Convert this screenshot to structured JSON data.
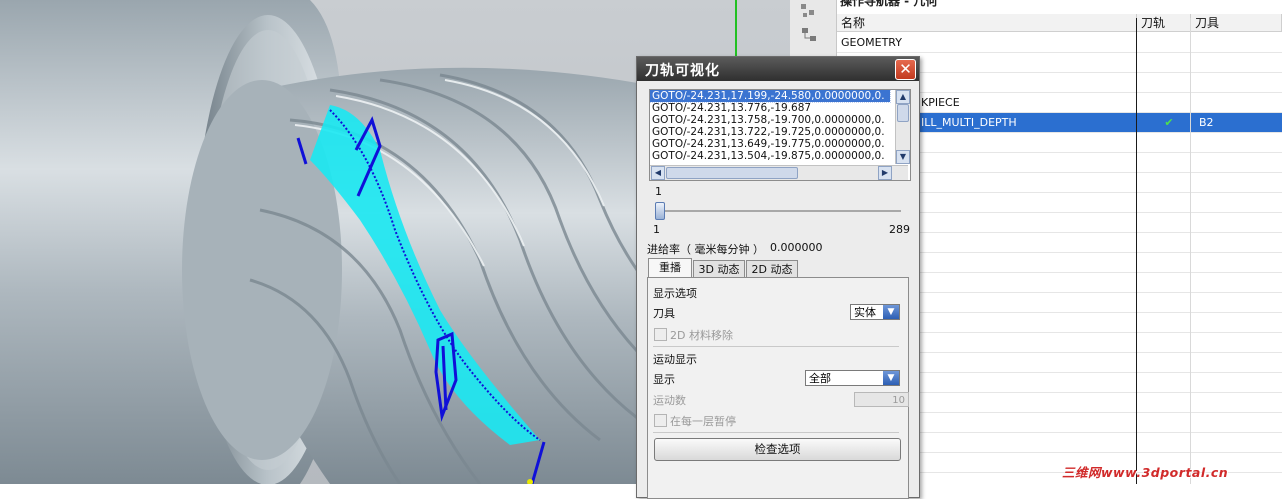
{
  "navigator": {
    "title": "操作导航器 - 几何",
    "columns": {
      "name": "名称",
      "path": "刀轨",
      "tool": "刀具"
    },
    "rows": [
      {
        "name": "GEOMETRY",
        "path": "",
        "tool": ""
      },
      {
        "name": "",
        "path": "",
        "tool": ""
      },
      {
        "name": "",
        "path": "",
        "tool": ""
      },
      {
        "name": "KPIECE",
        "path": "",
        "tool": ""
      },
      {
        "name": "ILL_MULTI_DEPTH",
        "path": "✔",
        "tool": "B2"
      }
    ]
  },
  "dialog": {
    "title": "刀轨可视化",
    "close_icon": "close-icon",
    "goto_lines": [
      "GOTO/-24.231,17.199,-24.580,0.0000000,0.",
      "GOTO/-24.231,13.776,-19.687",
      "GOTO/-24.231,13.758,-19.700,0.0000000,0.",
      "GOTO/-24.231,13.722,-19.725,0.0000000,0.",
      "GOTO/-24.231,13.649,-19.775,0.0000000,0.",
      "GOTO/-24.231,13.504,-19.875,0.0000000,0."
    ],
    "slider": {
      "current": "1",
      "min": "1",
      "max": "289",
      "fraction": 0.0
    },
    "feed_label": "进给率（ 毫米每分钟 ）",
    "feed_value": "0.000000",
    "tabs": [
      "重播",
      "3D 动态",
      "2D 动态"
    ],
    "display_options_heading": "显示选项",
    "tool_label": "刀具",
    "tool_value": "实体",
    "material_removal_label": "2D 材料移除",
    "motion_heading": "运动显示",
    "display_label": "显示",
    "display_value": "全部",
    "motion_count_label": "运动数",
    "motion_count_value": "10",
    "pause_label": "在每一层暂停",
    "check_options_label": "检查选项"
  },
  "watermark": "三维网www.3dportal.cn",
  "colors": {
    "toolpath": "#1010d8",
    "cut_area": "#19e8f2",
    "part": "#aeb8bf",
    "selection": "#2b6fd0",
    "title_bar": "#3a3a3a",
    "close": "#d4502f"
  }
}
